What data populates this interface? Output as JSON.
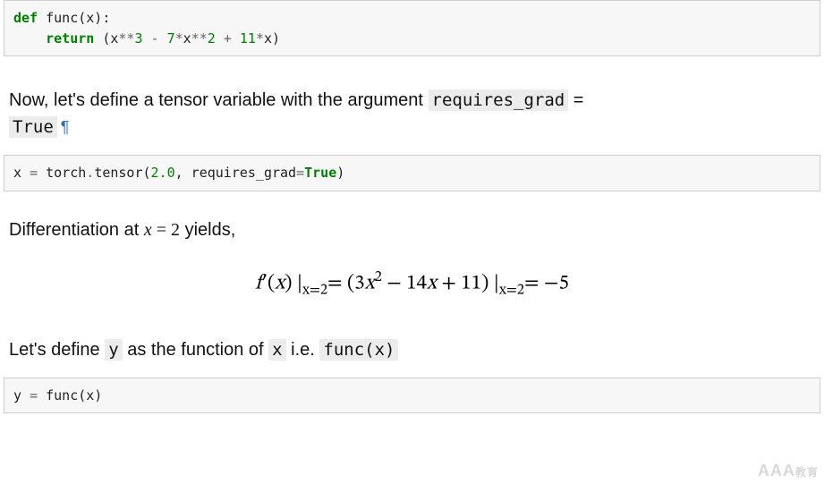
{
  "code1": {
    "kw_def": "def",
    "name": " func(x):",
    "indent": "    ",
    "kw_return": "return",
    "sp": " (x",
    "op1": "**",
    "n3": "3",
    "sp2": " ",
    "minus": "-",
    "sp3": " ",
    "n7": "7",
    "op2": "*",
    "x2": "x",
    "op3": "**",
    "n2": "2",
    "sp4": " ",
    "plus": "+",
    "sp5": " ",
    "n11": "11",
    "op4": "*",
    "x3": "x)"
  },
  "md1": {
    "t1": "Now, let's define a tensor variable with the argument ",
    "c1": "requires_grad",
    "t2": " = ",
    "c2": "True",
    "anchor": "¶"
  },
  "code2": {
    "l": "x ",
    "eq": "=",
    "s1": " torch",
    "dot": ".",
    "tensor": "tensor(",
    "v": "2.0",
    "comma": ", requires_grad",
    "eq2": "=",
    "true": "True",
    "close": ")"
  },
  "md2": {
    "t1": "Differentiation at ",
    "mx": "x",
    "eq": " = 2",
    "t2": " yields,"
  },
  "math": {
    "f": "f",
    "prime": "′",
    "open": "(",
    "x": "x",
    "close": ") |",
    "sub1": "x=2",
    "eq1": "= (3",
    "x2": "x",
    "sq": "2",
    "mid": " − 14",
    "x3": "x",
    "end": " + 11) |",
    "sub2": "x=2",
    "eq2": "= −5"
  },
  "md3": {
    "t1": "Let's define ",
    "c1": "y",
    "t2": " as the function of ",
    "c2": "x",
    "t3": " i.e. ",
    "c3": "func(x)"
  },
  "code3": {
    "l": "y ",
    "eq": "=",
    "r": " func(x)"
  },
  "watermark": {
    "big": "AAA",
    "small": "教育"
  }
}
